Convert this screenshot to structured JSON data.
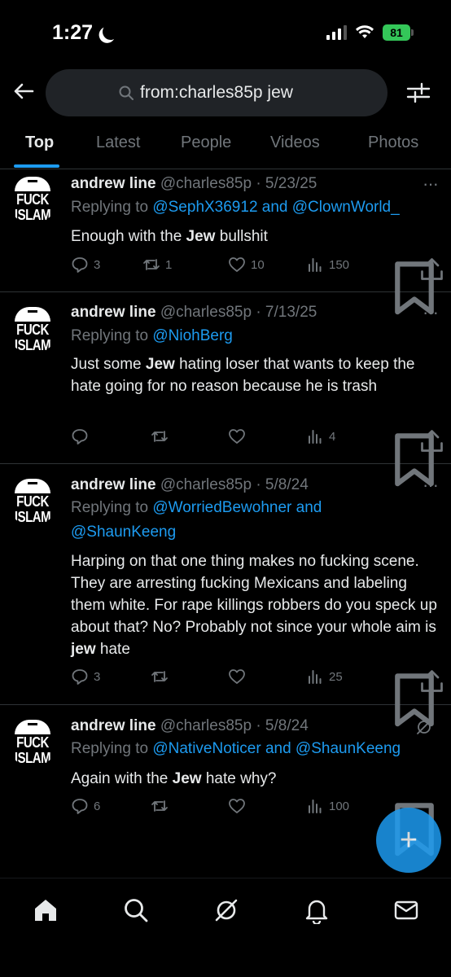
{
  "status_bar": {
    "time": "1:27",
    "battery": "81"
  },
  "search": {
    "query": "from:charles85p jew"
  },
  "tabs": [
    "Top",
    "Latest",
    "People",
    "Videos",
    "Photos"
  ],
  "avatar": {
    "line1": "FUCK",
    "line2": "ISLAM"
  },
  "posts": [
    {
      "name": "andrew line",
      "handle": "@charles85p · 5/23/25",
      "replying_prefix": "Replying to ",
      "replying_to": "@SephX36912 and @ClownWorld_",
      "text_before": "Enough with the ",
      "text_bold": "Jew",
      "text_after": " bullshit",
      "replies": "3",
      "reposts": "1",
      "likes": "10",
      "views": "150"
    },
    {
      "name": "andrew line",
      "handle": "@charles85p · 7/13/25",
      "replying_prefix": "Replying to ",
      "replying_to": "@NiohBerg",
      "text_before": "Just some ",
      "text_bold": "Jew",
      "text_after": " hating loser that wants to keep the hate going for no reason because he is trash",
      "replies": "",
      "reposts": "",
      "likes": "",
      "views": "4"
    },
    {
      "name": "andrew line",
      "handle": "@charles85p · 5/8/24",
      "replying_prefix": "Replying to ",
      "replying_to": "@WorriedBewohner and @ShaunKeeng",
      "text_before": "Harping on that one thing makes no fucking scene. They are arresting fucking Mexicans and labeling them white. For rape killings robbers do you speck up about that? No? Probably not since your whole aim is ",
      "text_bold": "jew",
      "text_after": " hate",
      "replies": "3",
      "reposts": "",
      "likes": "",
      "views": "25"
    },
    {
      "name": "andrew line",
      "handle": "@charles85p · 5/8/24",
      "replying_prefix": "Replying to ",
      "replying_to": "@NativeNoticer and @ShaunKeeng",
      "text_before": "Again with the ",
      "text_bold": "Jew",
      "text_after": " hate why?",
      "replies": "6",
      "reposts": "",
      "likes": "",
      "views": "100"
    }
  ],
  "fab": {
    "label": "+"
  },
  "colors": {
    "accent": "#1d9bf0",
    "muted": "#71767b",
    "background": "#000000"
  }
}
